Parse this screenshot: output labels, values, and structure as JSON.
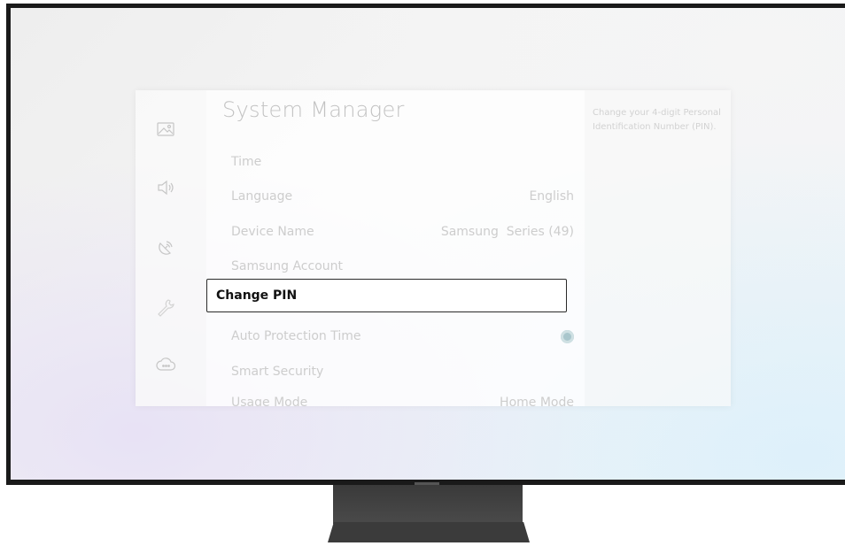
{
  "menu": {
    "title": "System Manager",
    "items": [
      {
        "label": "Time",
        "value": ""
      },
      {
        "label": "Language",
        "value": "English"
      },
      {
        "label": "Device Name",
        "value": "Samsung  Series (49)"
      },
      {
        "label": "Samsung Account",
        "value": ""
      },
      {
        "label": "Change PIN",
        "value": ""
      },
      {
        "label": "Auto Protection Time",
        "value": ""
      },
      {
        "label": "Smart Security",
        "value": ""
      },
      {
        "label": "Usage Mode",
        "value": "Home Mode"
      }
    ],
    "focused_index": 4,
    "auto_protection_time_toggle": "on"
  },
  "help": {
    "text": "Change your 4-digit Personal Identification Number (PIN)."
  },
  "sidebar": {
    "icons": [
      "picture-icon",
      "sound-icon",
      "broadcasting-icon",
      "wrench-icon",
      "support-icon"
    ],
    "selected_icon": "wrench-icon"
  },
  "colors": {
    "focus_border": "#2a2a2a",
    "toggle": "#a9c6cc",
    "bezel": "#1a1a1a"
  }
}
